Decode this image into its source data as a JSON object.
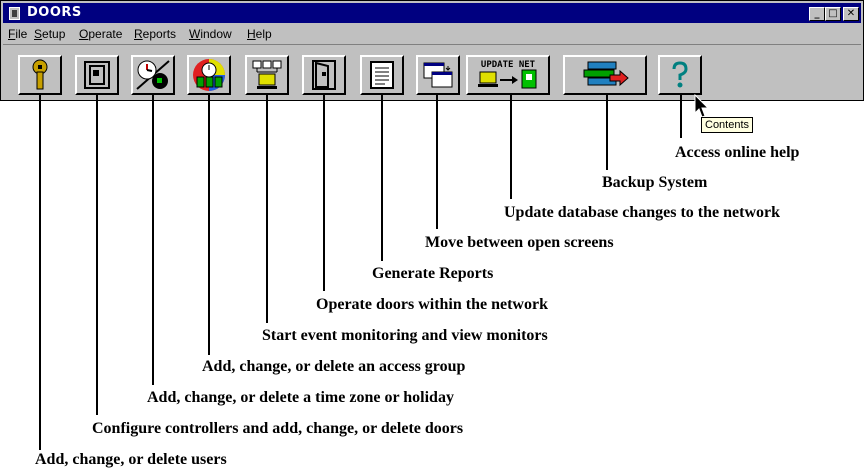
{
  "window": {
    "title": "DOORS",
    "controls": {
      "minimize": "_",
      "maximize": "□",
      "close": "✕"
    }
  },
  "menu": [
    "File",
    "Setup",
    "Operate",
    "Reports",
    "Window",
    "Help"
  ],
  "toolbar": {
    "buttons": [
      {
        "icon": "key-icon"
      },
      {
        "icon": "controller-door-icon"
      },
      {
        "icon": "clock-icon"
      },
      {
        "icon": "access-group-icon"
      },
      {
        "icon": "monitor-network-icon"
      },
      {
        "icon": "open-door-icon"
      },
      {
        "icon": "report-icon"
      },
      {
        "icon": "switch-screens-icon"
      },
      {
        "icon": "update-net-icon",
        "text": "UPDATE NET"
      },
      {
        "icon": "backup-icon"
      },
      {
        "icon": "help-icon"
      }
    ]
  },
  "tooltip": "Contents",
  "callouts": [
    "Access online help",
    "Backup System",
    "Update database changes to the network",
    "Move between open screens",
    "Generate Reports",
    "Operate doors within the network",
    "Start event monitoring and view monitors",
    "Add, change, or delete an access group",
    "Add, change, or delete a time zone or holiday",
    "Configure controllers and add, change, or delete doors",
    "Add, change, or delete users"
  ]
}
